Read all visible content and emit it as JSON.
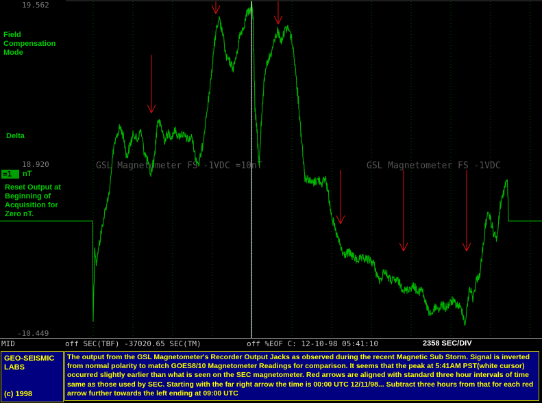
{
  "plot": {
    "y_max_label": "19.562",
    "y_mid_label": "18.920",
    "y_min_label": "-10.449",
    "watermark_1": "GSL Magnetometer FS -1VDC =10nT",
    "watermark_2": "GSL Magnetometer FS -1VDC",
    "unit_badge": "=1",
    "unit_label": "nT"
  },
  "side_labels": {
    "mode": "Field Compensation Mode",
    "delta": "Delta",
    "reset": "Reset Output at Beginning of Acquisition for Zero nT."
  },
  "status": {
    "mid": "MID",
    "sec_tbf": "off SEC(TBF) -37020.65 SEC(TM)",
    "eof": "off %EOF C: 12-10-98 05:41:10",
    "secdiv": "2358 SEC/DIV"
  },
  "footer": {
    "logo_line1": "GEO-SEISMIC",
    "logo_line2": "LABS",
    "logo_copyright": "(c) 1998",
    "description": "The output from the GSL Magnetometer's Recorder Output Jacks as observed during the recent Magnetic Sub Storm. Signal is inverted from normal polarity to match GOES8/10 Magnetometer Readings for comparison. It seems that the peak at 5:41AM PST(white cursor) occurred slightly earlier than what is seen on the SEC magnetometer. Red arrows are aligned with standard three hour intervals of time same as those used by SEC. Starting with the far right arrow the time is 00:00 UTC 12/11/98... Subtract three hours from that for each red arrow further towards the left ending at 09:00 UTC"
  },
  "colors": {
    "trace": "#00b400",
    "cursor": "#ffffff",
    "arrow": "#e01010",
    "grid": "#005000",
    "panel_bg": "#000080",
    "panel_text": "#ffff00"
  }
}
